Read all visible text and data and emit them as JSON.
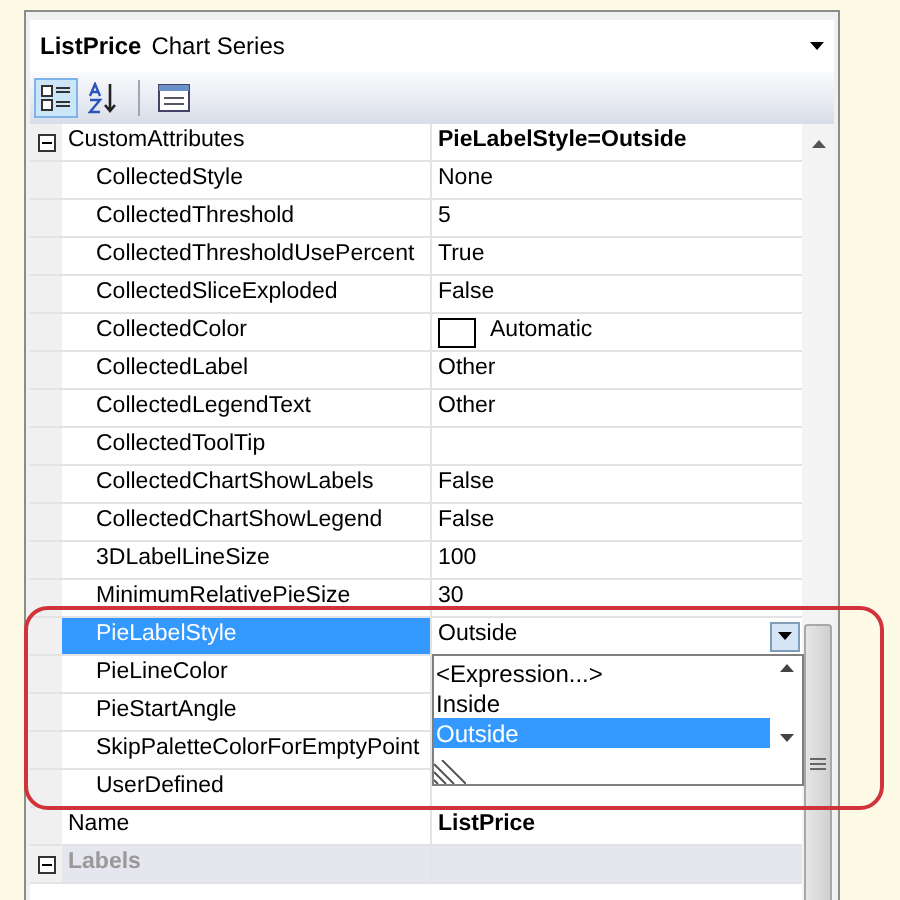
{
  "header": {
    "object_name": "ListPrice",
    "object_type": "Chart Series"
  },
  "toolbar": [
    {
      "kind": "categorized",
      "selected": true
    },
    {
      "kind": "alphabetical",
      "selected": false
    },
    {
      "kind": "separator"
    },
    {
      "kind": "pages",
      "selected": false
    }
  ],
  "rows": [
    {
      "kind": "category",
      "label": "CustomAttributes",
      "value": "PieLabelStyle=Outside",
      "modified": true,
      "expanded": true,
      "children": [
        {
          "kind": "text",
          "name": "CollectedStyle",
          "value": "None"
        },
        {
          "kind": "text",
          "name": "CollectedThreshold",
          "value": "5"
        },
        {
          "kind": "text",
          "name": "CollectedThresholdUsePercent",
          "value": "True"
        },
        {
          "kind": "text",
          "name": "CollectedSliceExploded",
          "value": "False"
        },
        {
          "kind": "color",
          "name": "CollectedColor",
          "value": "Automatic"
        },
        {
          "kind": "text",
          "name": "CollectedLabel",
          "value": "Other"
        },
        {
          "kind": "text",
          "name": "CollectedLegendText",
          "value": "Other"
        },
        {
          "kind": "text",
          "name": "CollectedToolTip"
        },
        {
          "kind": "text",
          "name": "CollectedChartShowLabels",
          "value": "False"
        },
        {
          "kind": "text",
          "name": "CollectedChartShowLegend",
          "value": "False"
        },
        {
          "kind": "text",
          "name": "3DLabelLineSize",
          "value": "100"
        },
        {
          "kind": "text",
          "name": "MinimumRelativePieSize",
          "value": "30"
        },
        {
          "kind": "dropdown",
          "name": "PieLabelStyle",
          "value": "Outside",
          "selected": true,
          "open": true,
          "options": [
            {
              "label": "<Expression...>",
              "selected": false
            },
            {
              "label": "Inside",
              "selected": false
            },
            {
              "label": "Outside",
              "selected": true
            }
          ]
        },
        {
          "kind": "text",
          "name": "PieLineColor"
        },
        {
          "kind": "text",
          "name": "PieStartAngle"
        },
        {
          "kind": "text",
          "name": "SkipPaletteColorForEmptyPoint"
        },
        {
          "kind": "text",
          "name": "UserDefined"
        }
      ]
    },
    {
      "kind": "text",
      "name": "Name",
      "value": "ListPrice",
      "modified": true
    },
    {
      "kind": "category",
      "label": "Labels",
      "expanded": true,
      "disabled": true,
      "children": []
    }
  ]
}
